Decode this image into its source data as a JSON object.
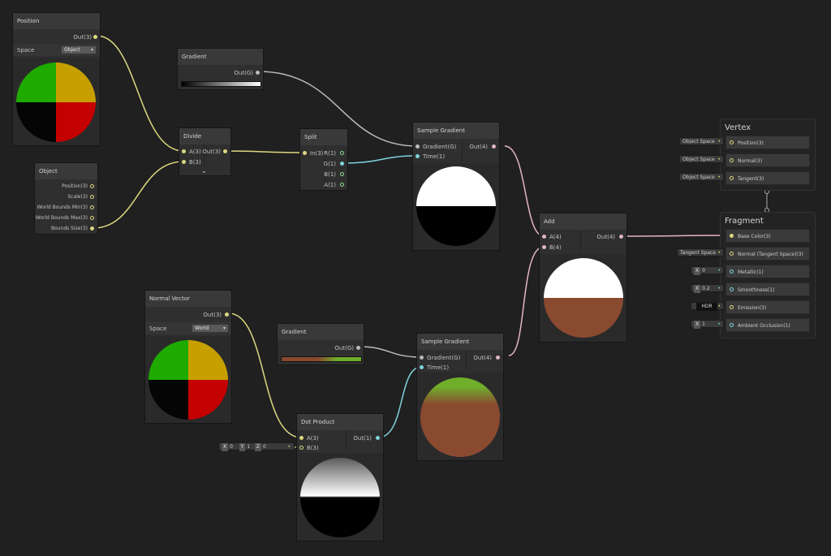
{
  "nodes": {
    "position": {
      "title": "Position",
      "out": "Out(3)",
      "space_label": "Space",
      "space_value": "Object"
    },
    "object": {
      "title": "Object",
      "outs": [
        "Position(3)",
        "Scale(3)",
        "World Bounds Min(3)",
        "World Bounds Max(3)",
        "Bounds Size(3)"
      ]
    },
    "gradient1": {
      "title": "Gradient",
      "out": "Out(G)"
    },
    "divide": {
      "title": "Divide",
      "in_a": "A(3)",
      "in_b": "B(3)",
      "out": "Out(3)"
    },
    "split": {
      "title": "Split",
      "in": "In(3)",
      "outs": [
        "R(1)",
        "G(1)",
        "B(1)",
        "A(1)"
      ]
    },
    "sample_gradient1": {
      "title": "Sample Gradient",
      "in_gradient": "Gradient(G)",
      "in_time": "Time(1)",
      "out": "Out(4)"
    },
    "add": {
      "title": "Add",
      "in_a": "A(4)",
      "in_b": "B(4)",
      "out": "Out(4)"
    },
    "normal_vector": {
      "title": "Normal Vector",
      "out": "Out(3)",
      "space_label": "Space",
      "space_value": "World"
    },
    "gradient2": {
      "title": "Gradient",
      "out": "Out(G)"
    },
    "sample_gradient2": {
      "title": "Sample Gradient",
      "in_gradient": "Gradient(G)",
      "in_time": "Time(1)",
      "out": "Out(4)"
    },
    "dot_product": {
      "title": "Dot Product",
      "in_a": "A(3)",
      "in_b": "B(3)",
      "out": "Out(1)",
      "b_x_label": "X",
      "b_x": "0",
      "b_y_label": "Y",
      "b_y": "1",
      "b_z_label": "Z",
      "b_z": "0"
    }
  },
  "vertex": {
    "title": "Vertex",
    "slots": [
      {
        "label": "Position(3)",
        "input": "Object Space"
      },
      {
        "label": "Normal(3)",
        "input": "Object Space"
      },
      {
        "label": "Tangent(3)",
        "input": "Object Space"
      }
    ]
  },
  "fragment": {
    "title": "Fragment",
    "slots": [
      {
        "label": "Base Color(3)"
      },
      {
        "label": "Normal (Tangent Space)(3)",
        "input": "Tangent Space"
      },
      {
        "label": "Metallic(1)",
        "input_label": "X",
        "input_value": "0"
      },
      {
        "label": "Smoothness(1)",
        "input_label": "X",
        "input_value": "0.2"
      },
      {
        "label": "Emission(3)",
        "input_value": "HDR"
      },
      {
        "label": "Ambient Occlusion(1)",
        "input_label": "X",
        "input_value": "1"
      }
    ]
  },
  "colors": {
    "background": "#202020",
    "vector3_port": "#dcd880",
    "gradient_port": "#bbbbbb",
    "float_port": "#7fd3dc",
    "vector4_port": "#e4b5c8",
    "soil_brown": "#8a4a30",
    "grass_green": "#6fae2a"
  }
}
